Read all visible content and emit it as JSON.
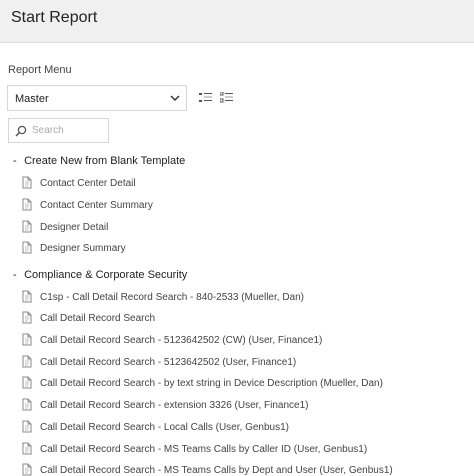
{
  "header": {
    "title": "Start Report"
  },
  "report_menu": {
    "label": "Report Menu",
    "selected": "Master"
  },
  "search": {
    "placeholder": "Search"
  },
  "groups": [
    {
      "label": "Create New from Blank Template",
      "items": [
        "Contact Center Detail",
        "Contact Center Summary",
        "Designer Detail",
        "Designer Summary"
      ]
    },
    {
      "label": "Compliance & Corporate Security",
      "items": [
        "C1sp - Call Detail Record Search - 840-2533 (Mueller, Dan)",
        "Call Detail Record Search",
        "Call Detail Record Search - 5123642502 (CW) (User, Finance1)",
        "Call Detail Record Search - 5123642502 (User, Finance1)",
        "Call Detail Record Search - by text string in Device Description (Mueller, Dan)",
        "Call Detail Record Search - extension 3326 (User, Finance1)",
        "Call Detail Record Search - Local Calls (User, Genbus1)",
        "Call Detail Record Search - MS Teams Calls by Caller ID (User, Genbus1)",
        "Call Detail Record Search - MS Teams Calls by Dept and User (User, Genbus1)"
      ]
    }
  ],
  "icons": {
    "chevron": "chevron-down-icon",
    "list_view": "list-view-icon",
    "tree_view": "tree-view-icon",
    "search": "search-icon",
    "report": "report-document-icon"
  }
}
